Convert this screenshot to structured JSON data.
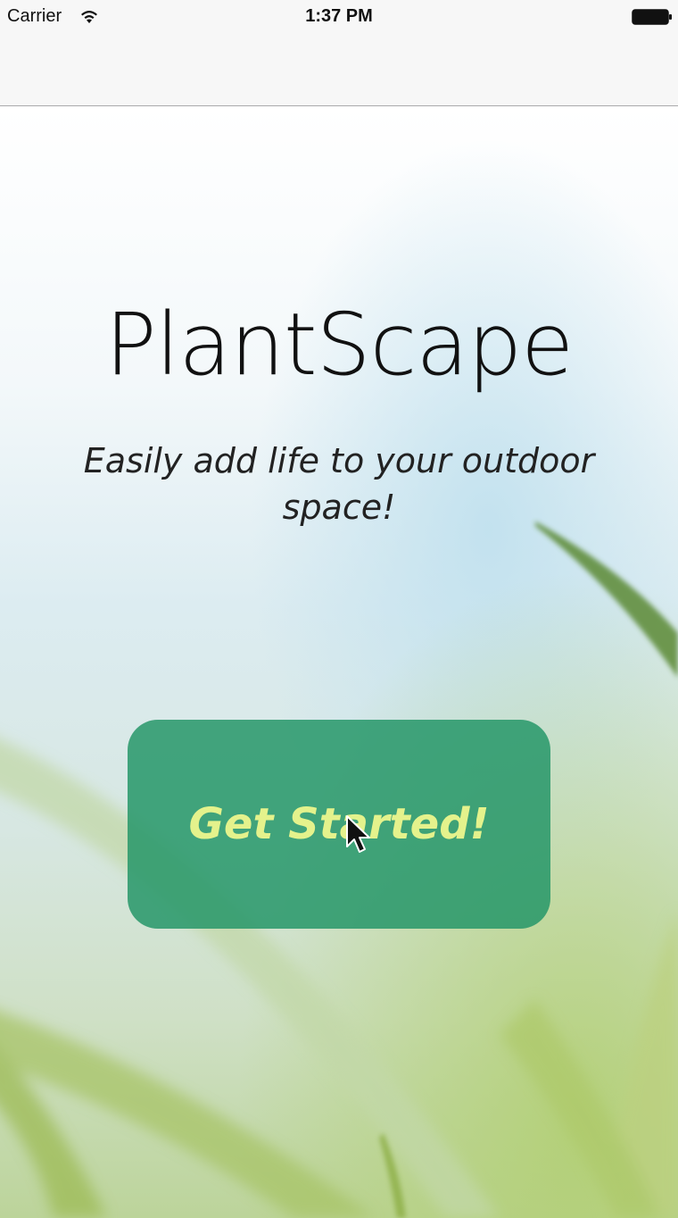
{
  "status_bar": {
    "carrier": "Carrier",
    "time": "1:37 PM",
    "wifi_icon": "wifi-icon",
    "battery_icon": "battery-icon"
  },
  "nav_bar": {
    "title": ""
  },
  "main": {
    "title": "PlantScape",
    "tagline": "Easily add life to your outdoor space!",
    "cta_label": "Get Started!"
  },
  "colors": {
    "cta_background": "#269669",
    "cta_text": "#e4f28c",
    "status_bar_bg": "#f7f7f7",
    "divider": "#a9a9ab"
  },
  "icons": {
    "cursor": "cursor-arrow-icon"
  }
}
